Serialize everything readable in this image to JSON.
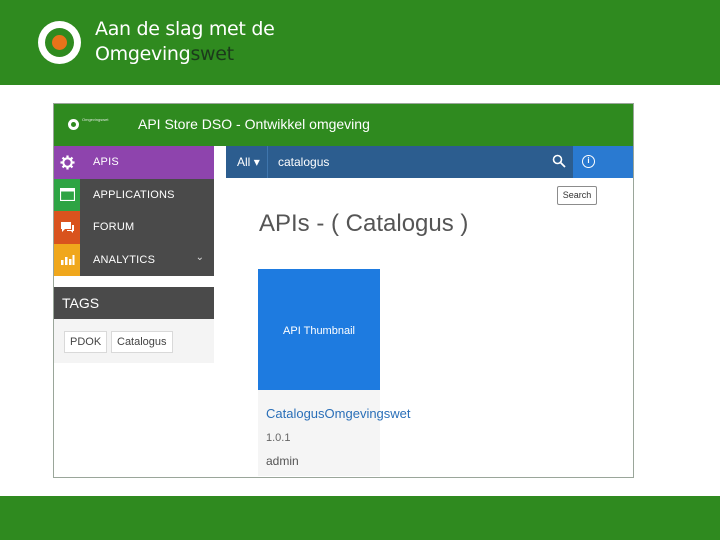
{
  "slide": {
    "title_line1": "Aan de slag met de",
    "title_line2_a": "Omgeving",
    "title_line2_b": "swet"
  },
  "app": {
    "logo_text": "Omgevingswet",
    "title": "API Store DSO - Ontwikkel omgeving"
  },
  "sidebar": {
    "items": [
      {
        "label": "APIS",
        "icon": "gear-icon",
        "color": "#8e44ad",
        "active": true
      },
      {
        "label": "APPLICATIONS",
        "icon": "window-icon",
        "color": "#2ea444",
        "active": false
      },
      {
        "label": "FORUM",
        "icon": "chat-icon",
        "color": "#d9531e",
        "active": false
      },
      {
        "label": "ANALYTICS",
        "icon": "bar-chart-icon",
        "color": "#f0a71c",
        "active": false
      }
    ]
  },
  "tags": {
    "header": "TAGS",
    "items": [
      "PDOK",
      "Catalogus"
    ]
  },
  "search": {
    "scope": "All",
    "value": "catalogus",
    "button_label": "Search"
  },
  "main": {
    "heading": "APIs - ( Catalogus )",
    "apis": [
      {
        "thumbnail_label": "API Thumbnail",
        "name": "CatalogusOmgevingswet",
        "version": "1.0.1",
        "owner": "admin"
      }
    ]
  },
  "colors": {
    "brand_green": "#2f8a1f",
    "search_bar": "#2c5d8f",
    "thumbnail_blue": "#1e7be0",
    "accent_orange": "#e8731a"
  }
}
